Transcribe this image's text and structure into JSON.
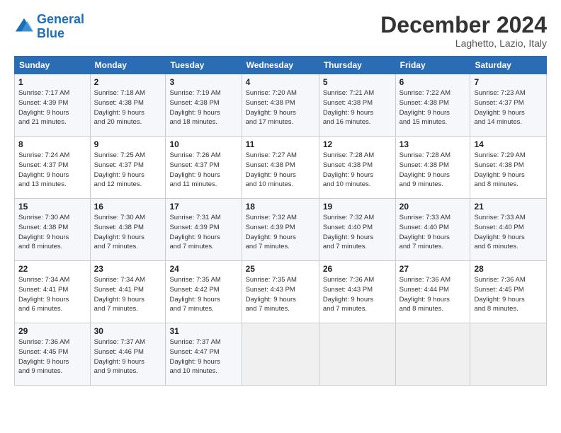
{
  "logo": {
    "line1": "General",
    "line2": "Blue"
  },
  "title": "December 2024",
  "location": "Laghetto, Lazio, Italy",
  "days_of_week": [
    "Sunday",
    "Monday",
    "Tuesday",
    "Wednesday",
    "Thursday",
    "Friday",
    "Saturday"
  ],
  "weeks": [
    [
      {
        "day": "1",
        "info": "Sunrise: 7:17 AM\nSunset: 4:39 PM\nDaylight: 9 hours\nand 21 minutes."
      },
      {
        "day": "2",
        "info": "Sunrise: 7:18 AM\nSunset: 4:38 PM\nDaylight: 9 hours\nand 20 minutes."
      },
      {
        "day": "3",
        "info": "Sunrise: 7:19 AM\nSunset: 4:38 PM\nDaylight: 9 hours\nand 18 minutes."
      },
      {
        "day": "4",
        "info": "Sunrise: 7:20 AM\nSunset: 4:38 PM\nDaylight: 9 hours\nand 17 minutes."
      },
      {
        "day": "5",
        "info": "Sunrise: 7:21 AM\nSunset: 4:38 PM\nDaylight: 9 hours\nand 16 minutes."
      },
      {
        "day": "6",
        "info": "Sunrise: 7:22 AM\nSunset: 4:38 PM\nDaylight: 9 hours\nand 15 minutes."
      },
      {
        "day": "7",
        "info": "Sunrise: 7:23 AM\nSunset: 4:37 PM\nDaylight: 9 hours\nand 14 minutes."
      }
    ],
    [
      {
        "day": "8",
        "info": "Sunrise: 7:24 AM\nSunset: 4:37 PM\nDaylight: 9 hours\nand 13 minutes."
      },
      {
        "day": "9",
        "info": "Sunrise: 7:25 AM\nSunset: 4:37 PM\nDaylight: 9 hours\nand 12 minutes."
      },
      {
        "day": "10",
        "info": "Sunrise: 7:26 AM\nSunset: 4:37 PM\nDaylight: 9 hours\nand 11 minutes."
      },
      {
        "day": "11",
        "info": "Sunrise: 7:27 AM\nSunset: 4:38 PM\nDaylight: 9 hours\nand 10 minutes."
      },
      {
        "day": "12",
        "info": "Sunrise: 7:28 AM\nSunset: 4:38 PM\nDaylight: 9 hours\nand 10 minutes."
      },
      {
        "day": "13",
        "info": "Sunrise: 7:28 AM\nSunset: 4:38 PM\nDaylight: 9 hours\nand 9 minutes."
      },
      {
        "day": "14",
        "info": "Sunrise: 7:29 AM\nSunset: 4:38 PM\nDaylight: 9 hours\nand 8 minutes."
      }
    ],
    [
      {
        "day": "15",
        "info": "Sunrise: 7:30 AM\nSunset: 4:38 PM\nDaylight: 9 hours\nand 8 minutes."
      },
      {
        "day": "16",
        "info": "Sunrise: 7:30 AM\nSunset: 4:38 PM\nDaylight: 9 hours\nand 7 minutes."
      },
      {
        "day": "17",
        "info": "Sunrise: 7:31 AM\nSunset: 4:39 PM\nDaylight: 9 hours\nand 7 minutes."
      },
      {
        "day": "18",
        "info": "Sunrise: 7:32 AM\nSunset: 4:39 PM\nDaylight: 9 hours\nand 7 minutes."
      },
      {
        "day": "19",
        "info": "Sunrise: 7:32 AM\nSunset: 4:40 PM\nDaylight: 9 hours\nand 7 minutes."
      },
      {
        "day": "20",
        "info": "Sunrise: 7:33 AM\nSunset: 4:40 PM\nDaylight: 9 hours\nand 7 minutes."
      },
      {
        "day": "21",
        "info": "Sunrise: 7:33 AM\nSunset: 4:40 PM\nDaylight: 9 hours\nand 6 minutes."
      }
    ],
    [
      {
        "day": "22",
        "info": "Sunrise: 7:34 AM\nSunset: 4:41 PM\nDaylight: 9 hours\nand 6 minutes."
      },
      {
        "day": "23",
        "info": "Sunrise: 7:34 AM\nSunset: 4:41 PM\nDaylight: 9 hours\nand 7 minutes."
      },
      {
        "day": "24",
        "info": "Sunrise: 7:35 AM\nSunset: 4:42 PM\nDaylight: 9 hours\nand 7 minutes."
      },
      {
        "day": "25",
        "info": "Sunrise: 7:35 AM\nSunset: 4:43 PM\nDaylight: 9 hours\nand 7 minutes."
      },
      {
        "day": "26",
        "info": "Sunrise: 7:36 AM\nSunset: 4:43 PM\nDaylight: 9 hours\nand 7 minutes."
      },
      {
        "day": "27",
        "info": "Sunrise: 7:36 AM\nSunset: 4:44 PM\nDaylight: 9 hours\nand 8 minutes."
      },
      {
        "day": "28",
        "info": "Sunrise: 7:36 AM\nSunset: 4:45 PM\nDaylight: 9 hours\nand 8 minutes."
      }
    ],
    [
      {
        "day": "29",
        "info": "Sunrise: 7:36 AM\nSunset: 4:45 PM\nDaylight: 9 hours\nand 9 minutes."
      },
      {
        "day": "30",
        "info": "Sunrise: 7:37 AM\nSunset: 4:46 PM\nDaylight: 9 hours\nand 9 minutes."
      },
      {
        "day": "31",
        "info": "Sunrise: 7:37 AM\nSunset: 4:47 PM\nDaylight: 9 hours\nand 10 minutes."
      },
      {
        "day": "",
        "info": ""
      },
      {
        "day": "",
        "info": ""
      },
      {
        "day": "",
        "info": ""
      },
      {
        "day": "",
        "info": ""
      }
    ]
  ]
}
